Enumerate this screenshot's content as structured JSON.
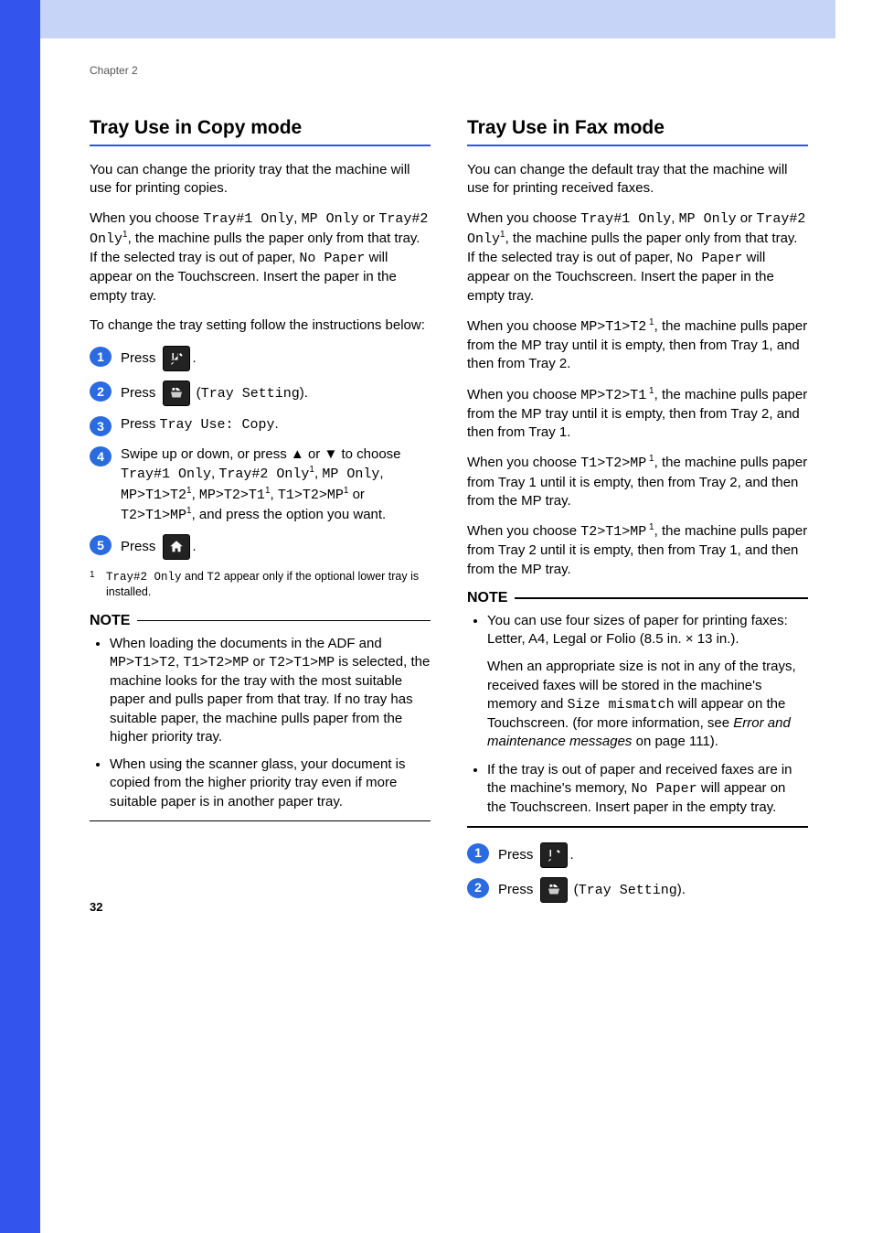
{
  "chapter": "Chapter 2",
  "page_number": "32",
  "left": {
    "title": "Tray Use in Copy mode",
    "p1": "You can change the priority tray that the machine will use for printing copies.",
    "p2a": "When you choose ",
    "p2b": "Tray#1 Only",
    "p2c": ", ",
    "p2d": "MP Only",
    "p2e": " or ",
    "p2f": "Tray#2 Only",
    "p2g": ", the machine pulls the paper only from that tray. If the selected tray is out of paper, ",
    "p2h": "No Paper",
    "p2i": " will appear on the Touchscreen. Insert the paper in the empty tray.",
    "p3": "To change the tray setting follow the instructions below:",
    "step1": "Press ",
    "step2a": "Press ",
    "step2b": " (",
    "step2c": "Tray Setting",
    "step2d": ").",
    "step3a": "Press ",
    "step3b": "Tray Use: Copy",
    "step3c": ".",
    "step4a": "Swipe up or down, or press ▲ or ▼ to choose ",
    "step4b": "Tray#1 Only",
    "step4c": ", ",
    "step4d": "Tray#2 Only",
    "step4e": ", ",
    "step4f": "MP Only",
    "step4g": ", ",
    "step4h": "MP>T1>T2",
    "step4i": ", ",
    "step4j": "MP>T2>T1",
    "step4k": ", ",
    "step4l": "T1>T2>MP",
    "step4m": " or ",
    "step4n": "T2>T1>MP",
    "step4o": ", and press the option you want.",
    "step5": "Press ",
    "fn1a": "Tray#2 Only",
    "fn1b": " and ",
    "fn1c": "T2",
    "fn1d": " appear only if the optional lower tray is installed.",
    "note_label": "NOTE",
    "note1a": "When loading the documents in the ADF and ",
    "note1b": "MP>T1>T2",
    "note1c": ", ",
    "note1d": "T1>T2>MP",
    "note1e": " or ",
    "note1f": "T2>T1>MP",
    "note1g": " is selected, the machine looks for the tray with the most suitable paper and pulls paper from that tray. If no tray has suitable paper, the machine pulls paper from the higher priority tray.",
    "note2": "When using the scanner glass, your document is copied from the higher priority tray even if more suitable paper is in another paper tray."
  },
  "right": {
    "title": "Tray Use in Fax mode",
    "p1": "You can change the default tray that the machine will use for printing received faxes.",
    "p2a": "When you choose ",
    "p2b": "Tray#1 Only",
    "p2c": ", ",
    "p2d": "MP Only",
    "p2e": " or ",
    "p2f": "Tray#2 Only",
    "p2g": ", the machine pulls the paper only from that tray. If the selected tray is out of paper, ",
    "p2h": "No Paper",
    "p2i": " will appear on the Touchscreen. Insert the paper in the empty tray.",
    "p3a": "When you choose ",
    "p3b": "MP>T1>T2",
    "p3c": ", the machine pulls paper from the MP tray until it is empty, then from Tray 1, and then from Tray 2.",
    "p4a": "When you choose ",
    "p4b": "MP>T2>T1",
    "p4c": ", the machine pulls paper from the MP tray until it is empty, then from Tray 2, and then from Tray 1.",
    "p5a": "When you choose ",
    "p5b": "T1>T2>MP",
    "p5c": ", the machine pulls paper from Tray 1 until it is empty, then from Tray 2, and then from the MP tray.",
    "p6a": "When you choose ",
    "p6b": "T2>T1>MP",
    "p6c": ", the machine pulls paper from Tray 2 until it is empty, then from Tray 1, and then from the MP tray.",
    "note_label": "NOTE",
    "note1": "You can use four sizes of paper for printing faxes: Letter, A4, Legal or Folio (8.5 in. × 13 in.).",
    "note2a": "When an appropriate size is not in any of the trays, received faxes will be stored in the machine's memory and ",
    "note2b": "Size mismatch",
    "note2c": " will appear on the Touchscreen. (for more information, see ",
    "note2d": "Error and maintenance messages",
    "note2e": " on page 111).",
    "note3a": "If the tray is out of paper and received faxes are in the machine's memory, ",
    "note3b": "No Paper",
    "note3c": " will appear on the Touchscreen. Insert paper in the empty tray.",
    "step1": "Press ",
    "step2a": "Press ",
    "step2b": " (",
    "step2c": "Tray Setting",
    "step2d": ")."
  }
}
